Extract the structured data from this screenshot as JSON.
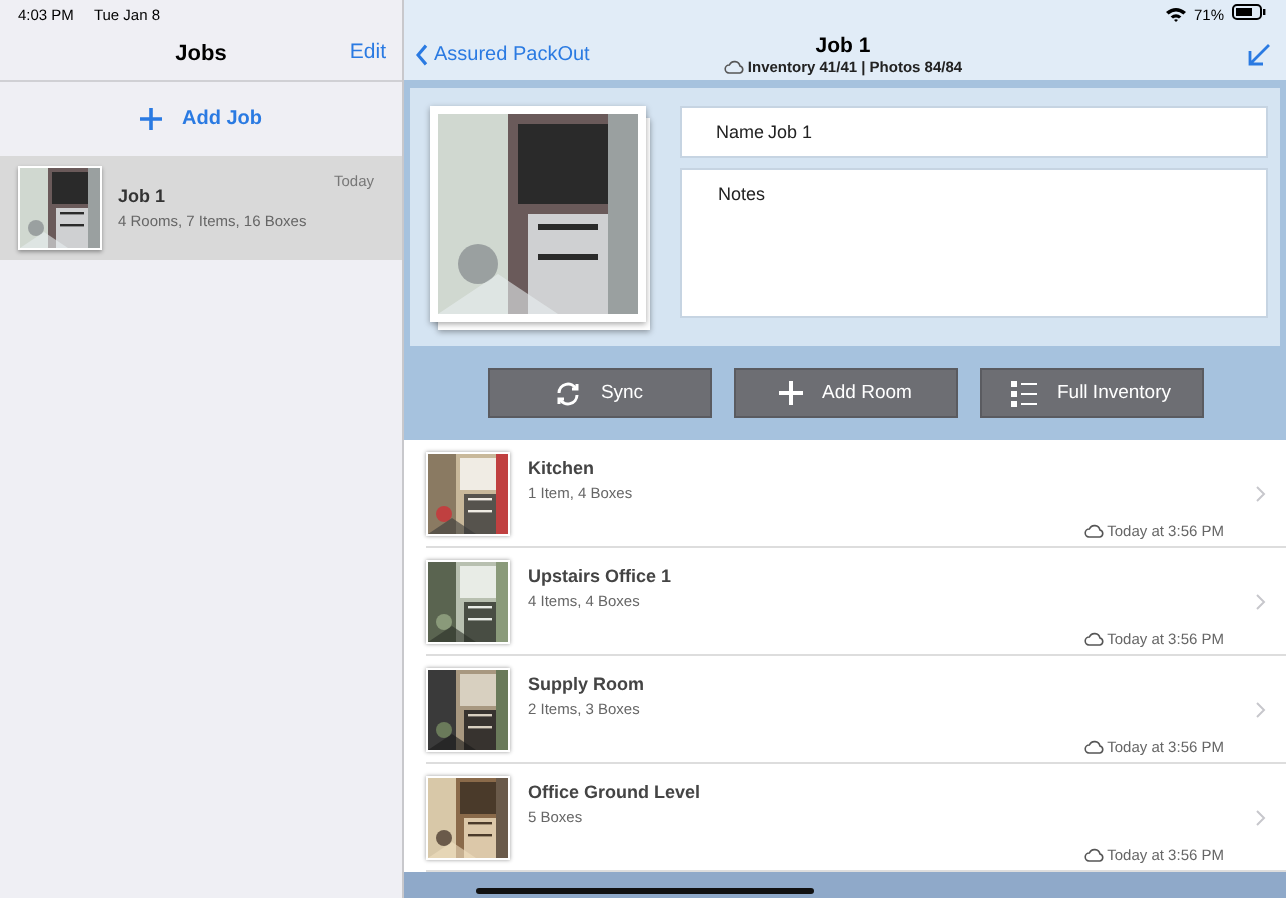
{
  "status_bar": {
    "time": "4:03 PM",
    "date": "Tue Jan 8",
    "battery": "71%"
  },
  "sidebar": {
    "title": "Jobs",
    "edit": "Edit",
    "add_job": "Add Job",
    "jobs": [
      {
        "name": "Job 1",
        "summary": "4 Rooms, 7 Items, 16 Boxes",
        "date": "Today",
        "selected": true
      }
    ]
  },
  "detail": {
    "back": "Assured PackOut",
    "title": "Job 1",
    "sync_status": "Inventory 41/41 | Photos 84/84",
    "name_field": {
      "label": "Name",
      "value": "Job 1"
    },
    "notes_field": {
      "placeholder": "Notes"
    },
    "buttons": [
      {
        "label": "Sync",
        "kind": "sync"
      },
      {
        "label": "Add Room",
        "kind": "add"
      },
      {
        "label": "Full Inventory",
        "kind": "list"
      }
    ],
    "rooms": [
      {
        "name": "Kitchen",
        "summary": "1 Item, 4 Boxes",
        "synced": "Today at 3:56 PM"
      },
      {
        "name": "Upstairs Office 1",
        "summary": "4 Items, 4 Boxes",
        "synced": "Today at 3:56 PM"
      },
      {
        "name": "Supply Room",
        "summary": "2 Items, 3 Boxes",
        "synced": "Today at 3:56 PM"
      },
      {
        "name": "Office Ground Level",
        "summary": "5 Boxes",
        "synced": "Today at 3:56 PM"
      }
    ]
  }
}
